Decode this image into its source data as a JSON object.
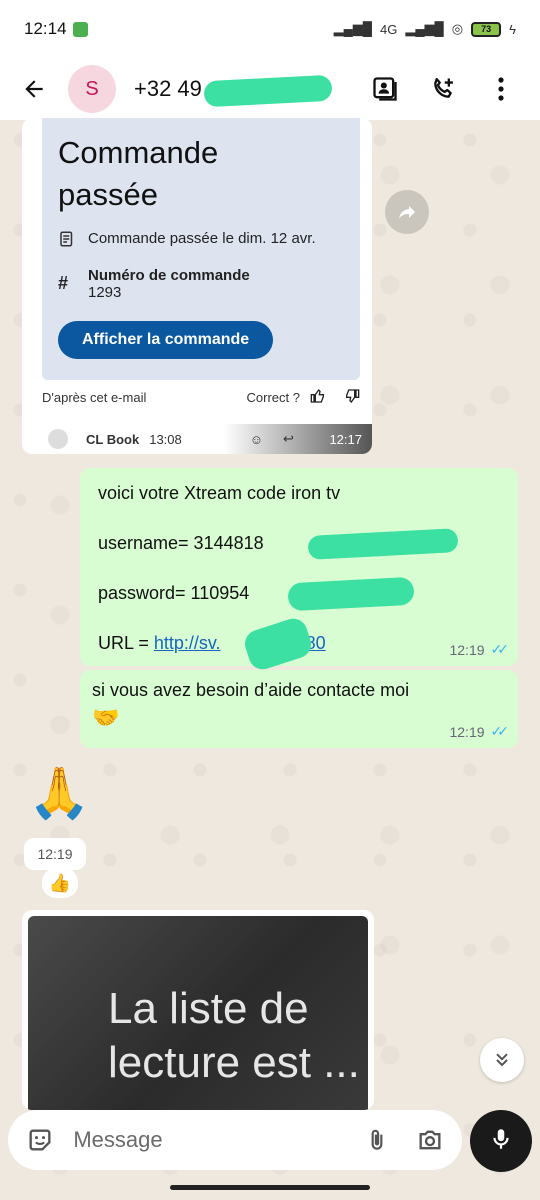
{
  "status_bar": {
    "time": "12:14",
    "battery": "73",
    "network": "4G"
  },
  "header": {
    "avatar_letter": "S",
    "contact_name": "+32 49"
  },
  "order_card": {
    "title_line1": "Commande",
    "title_line2": "passée",
    "placed_text": "Commande passée le dim. 12 avr.",
    "order_number_label": "Numéro de commande",
    "order_number": "1293",
    "button_label": "Afficher la commande",
    "from_email": "D'après cet e-mail",
    "correct_label": "Correct ?",
    "sender": "CL Book",
    "sender_time": "13:08",
    "time": "12:17"
  },
  "messages": [
    {
      "line1": "voici votre Xtream code iron tv",
      "line2": "username= 3144818",
      "line3": "password= 110954",
      "url_prefix": "URL = ",
      "url": "http://sv.",
      "url_suffix": ".8080",
      "time": "12:19"
    },
    {
      "text": "si vous avez besoin d’aide contacte moi",
      "emoji": "🤝",
      "time": "12:19"
    }
  ],
  "incoming": {
    "emoji": "🙏",
    "time": "12:19",
    "reaction": "👍"
  },
  "video": {
    "text_line1": "La liste de",
    "text_line2": "lecture est ..."
  },
  "composer": {
    "placeholder": "Message"
  },
  "colors": {
    "outgoing_bubble": "#d9fdd3",
    "button_blue": "#0b57a0",
    "read_ticks": "#34b7f1"
  }
}
